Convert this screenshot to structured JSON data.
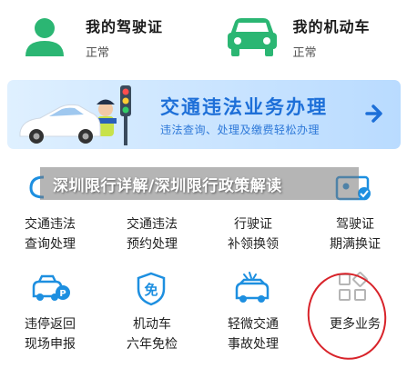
{
  "top_cards": [
    {
      "title": "我的驾驶证",
      "status": "正常",
      "icon": "user-icon"
    },
    {
      "title": "我的机动车",
      "status": "正常",
      "icon": "car-icon"
    }
  ],
  "banner": {
    "title": "交通违法业务办理",
    "subtitle": "违法查询、处理及缴费轻松办理",
    "icon": "chevron-right-icon"
  },
  "headline": "深圳限行详解/深圳限行政策解读",
  "grid_row1": [
    {
      "line1": "交通违法",
      "line2": "查询处理"
    },
    {
      "line1": "交通违法",
      "line2": "预约处理"
    },
    {
      "line1": "行驶证",
      "line2": "补领换领"
    },
    {
      "line1": "驾驶证",
      "line2": "期满换证"
    }
  ],
  "grid_row2": [
    {
      "line1": "违停返回",
      "line2": "现场申报",
      "icon": "parking-car-icon"
    },
    {
      "line1": "机动车",
      "line2": "六年免检",
      "icon": "exempt-badge-icon",
      "badge": "免"
    },
    {
      "line1": "轻微交通",
      "line2": "事故处理",
      "icon": "car-accident-icon"
    },
    {
      "line1": "更多业务",
      "line2": "",
      "icon": "grid-more-icon"
    }
  ],
  "colors": {
    "green": "#2bb673",
    "blue": "#1d6fd8",
    "annotation_red": "#d8232a"
  }
}
